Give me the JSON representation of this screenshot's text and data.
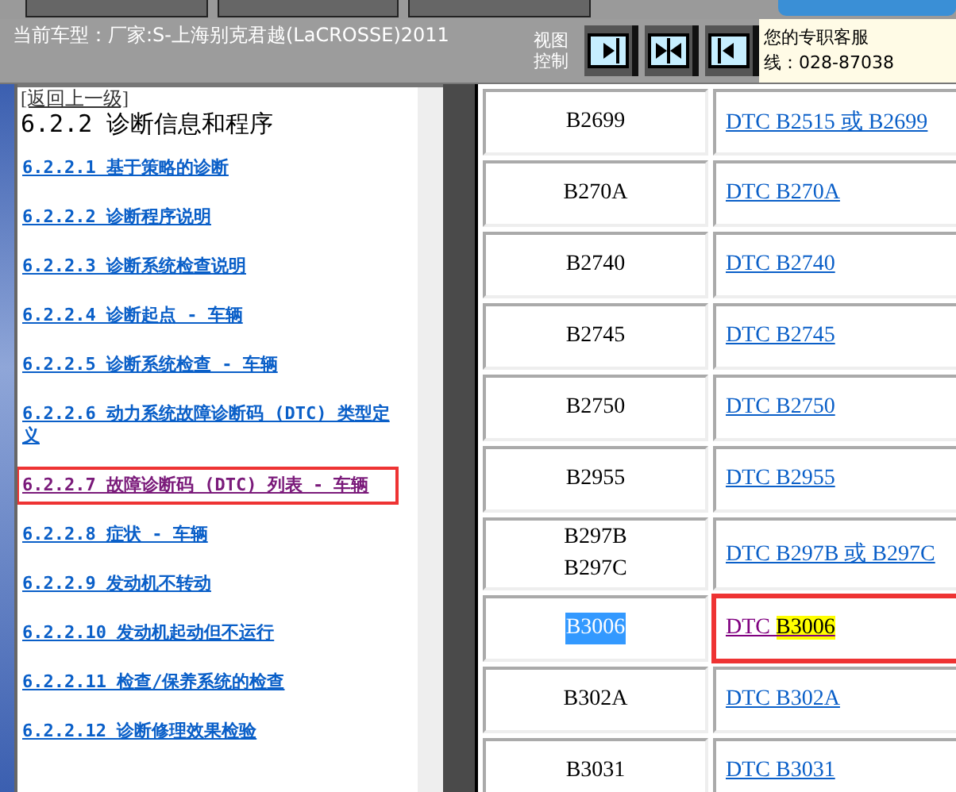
{
  "toolbar_tabs": [
    {
      "selected": false
    },
    {
      "selected": false
    },
    {
      "selected": false
    },
    {
      "selected": true
    }
  ],
  "header": {
    "vehicle": "当前车型：厂家:S-上海别克君越(LaCROSSE)2011",
    "view_label": "视图控制",
    "view_buttons": [
      {
        "kind": "right",
        "selected": false
      },
      {
        "kind": "both",
        "selected": false
      },
      {
        "kind": "left",
        "selected": false
      }
    ],
    "service_lines": [
      "您的专职客服",
      "线：028-87038"
    ]
  },
  "nav": {
    "back": "[返回上一级]",
    "title": "6.2.2 诊断信息和程序",
    "items": [
      {
        "label": "6.2.2.1 基于策略的诊断",
        "selected": false
      },
      {
        "label": "6.2.2.2 诊断程序说明",
        "selected": false
      },
      {
        "label": "6.2.2.3 诊断系统检查说明",
        "selected": false
      },
      {
        "label": "6.2.2.4 诊断起点 - 车辆",
        "selected": false
      },
      {
        "label": "6.2.2.5 诊断系统检查 - 车辆",
        "selected": false
      },
      {
        "label": "6.2.2.6 动力系统故障诊断码 (DTC) 类型定义",
        "selected": false
      },
      {
        "label": "6.2.2.7 故障诊断码 (DTC) 列表 - 车辆",
        "selected": true
      },
      {
        "label": "6.2.2.8 症状 - 车辆",
        "selected": false
      },
      {
        "label": "6.2.2.9 发动机不转动",
        "selected": false
      },
      {
        "label": "6.2.2.10 发动机起动但不运行",
        "selected": false
      },
      {
        "label": "6.2.2.11 检查/保养系统的检查",
        "selected": false
      },
      {
        "label": "6.2.2.12 诊断修理效果检验",
        "selected": false
      }
    ]
  },
  "table": {
    "rows": [
      {
        "codes": [
          "B2699"
        ],
        "link": "DTC B2515 或 B2699",
        "selected": false
      },
      {
        "codes": [
          "B270A"
        ],
        "link": "DTC B270A",
        "selected": false
      },
      {
        "codes": [
          "B2740"
        ],
        "link": "DTC B2740",
        "selected": false
      },
      {
        "codes": [
          "B2745"
        ],
        "link": "DTC B2745",
        "selected": false
      },
      {
        "codes": [
          "B2750"
        ],
        "link": "DTC B2750",
        "selected": false
      },
      {
        "codes": [
          "B2955"
        ],
        "link": "DTC B2955",
        "selected": false
      },
      {
        "codes": [
          "B297B",
          "B297C"
        ],
        "link": "DTC B297B 或 B297C",
        "selected": false
      },
      {
        "codes": [
          "B3006"
        ],
        "link": "DTC ",
        "highlight": "B3006",
        "selected": true
      },
      {
        "codes": [
          "B302A"
        ],
        "link": "DTC B302A",
        "selected": false
      },
      {
        "codes": [
          "B3031"
        ],
        "link": "DTC B3031",
        "selected": false
      }
    ]
  }
}
